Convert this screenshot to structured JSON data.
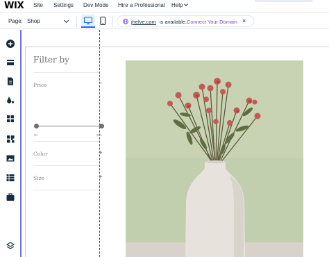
{
  "menubar": {
    "logo": "WIX",
    "items": [
      {
        "label": "Site"
      },
      {
        "label": "Settings"
      },
      {
        "label": "Dev Mode"
      },
      {
        "label": "Hire a Professional"
      },
      {
        "label": "Help"
      }
    ]
  },
  "toolbar": {
    "page_label": "Page:",
    "page_value": "Shop",
    "domain": "jhelve.com",
    "availability": "is available.",
    "connect_label": "Connect Your Domain",
    "close_glyph": "×"
  },
  "rail": {
    "tools": [
      "add-icon",
      "sections-icon",
      "pages-icon",
      "design-icon",
      "apps-icon",
      "business-icon",
      "media-icon",
      "cms-icon",
      "portfolio-icon",
      "layers-icon"
    ]
  },
  "filter": {
    "title": "Filter by",
    "price_label": "Price",
    "price_symbol": "−",
    "price_min_label": "$4",
    "price_max_label": "$50",
    "color_label": "Color",
    "color_symbol": "+",
    "size_label": "Size",
    "size_symbol": "+"
  },
  "colors": {
    "accent": "#116dff",
    "rail_border": "#6a72ff",
    "connect": "#7a49d4",
    "photo_bg": "#c2cfae",
    "vase": "#e7e3dc"
  }
}
